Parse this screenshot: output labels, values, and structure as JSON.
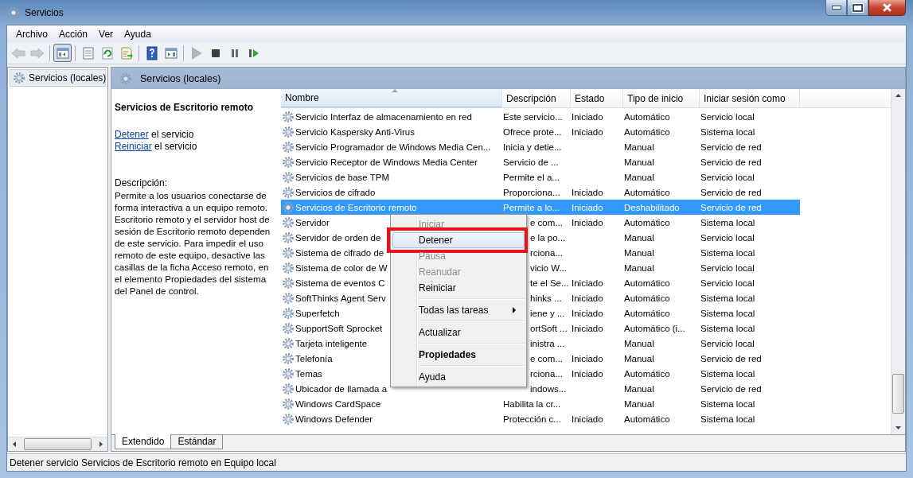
{
  "window": {
    "title": "Servicios"
  },
  "menu_bar": [
    "Archivo",
    "Acción",
    "Ver",
    "Ayuda"
  ],
  "toolbar": [
    {
      "kind": "back",
      "disabled": true
    },
    {
      "kind": "forward",
      "disabled": true
    },
    {
      "kind": "separator"
    },
    {
      "kind": "tree",
      "pressed": true
    },
    {
      "kind": "separator"
    },
    {
      "kind": "properties"
    },
    {
      "kind": "refresh"
    },
    {
      "kind": "export"
    },
    {
      "kind": "separator"
    },
    {
      "kind": "help"
    },
    {
      "kind": "panel"
    },
    {
      "kind": "separator"
    },
    {
      "kind": "play",
      "disabled": true
    },
    {
      "kind": "stop"
    },
    {
      "kind": "pause"
    },
    {
      "kind": "resume"
    }
  ],
  "tree": {
    "items": [
      {
        "label": "Servicios (locales)",
        "selected": true
      }
    ]
  },
  "pane_header": "Servicios (locales)",
  "details": {
    "title": "Servicios de Escritorio remoto",
    "actions": [
      {
        "link": "Detener",
        "text": "el servicio"
      },
      {
        "link": "Reiniciar",
        "text": "el servicio"
      }
    ],
    "description_label": "Descripción:",
    "description": "Permite a los usuarios conectarse de forma interactiva a un equipo remoto. Escritorio remoto y el servidor host de sesión de Escritorio remoto dependen de este servicio. Para impedir el uso remoto de este equipo, desactive las casillas de la ficha Acceso remoto, en el elemento Propiedades del sistema del Panel de control."
  },
  "table": {
    "columns": [
      {
        "label": "Nombre",
        "sorted": true
      },
      {
        "label": "Descripción",
        "sorted": false
      },
      {
        "label": "Estado",
        "sorted": false
      },
      {
        "label": "Tipo de inicio",
        "sorted": false
      },
      {
        "label": "Iniciar sesión como",
        "sorted": false
      }
    ],
    "rows": [
      {
        "name": "Servicio Interfaz de almacenamiento en red",
        "description": "Este servicio...",
        "status": "Iniciado",
        "startup": "Automático",
        "logon": "Servicio local",
        "selected": false
      },
      {
        "name": "Servicio Kaspersky Anti-Virus",
        "description": "Ofrece prote...",
        "status": "Iniciado",
        "startup": "Automático",
        "logon": "Sistema local",
        "selected": false
      },
      {
        "name": "Servicio Programador de Windows Media Cen...",
        "description": "Inicia y detie...",
        "startup": "Manual",
        "logon": "Servicio de red",
        "selected": false
      },
      {
        "name": "Servicio Receptor de Windows Media Center",
        "description": "Servicio de ...",
        "startup": "Manual",
        "logon": "Servicio de red",
        "selected": false
      },
      {
        "name": "Servicios de base TPM",
        "description": "Permite el a...",
        "startup": "Manual",
        "logon": "Servicio local",
        "selected": false
      },
      {
        "name": "Servicios de cifrado",
        "description": "Proporciona...",
        "status": "Iniciado",
        "startup": "Automático",
        "logon": "Servicio de red",
        "selected": false
      },
      {
        "name": "Servicios de Escritorio remoto",
        "description": "Permite a lo...",
        "status": "Iniciado",
        "startup": "Deshabilitado",
        "logon": "Servicio de red",
        "selected": true
      },
      {
        "name": "Servidor",
        "description": "e com...",
        "status": "Iniciado",
        "startup": "Automático",
        "logon": "Sistema local",
        "selected": false
      },
      {
        "name": "Servidor de orden de",
        "description": "e la po...",
        "startup": "Manual",
        "logon": "Servicio local",
        "selected": false
      },
      {
        "name": "Sistema de cifrado de",
        "description": "rciona...",
        "startup": "Manual",
        "logon": "Sistema local",
        "selected": false
      },
      {
        "name": "Sistema de color de W",
        "description": "vicio W...",
        "startup": "Manual",
        "logon": "Servicio local",
        "selected": false
      },
      {
        "name": "Sistema de eventos C",
        "description": "te el Se...",
        "status": "Iniciado",
        "startup": "Automático",
        "logon": "Servicio local",
        "selected": false
      },
      {
        "name": "SoftThinks Agent Serv",
        "description": "hinks ...",
        "status": "Iniciado",
        "startup": "Automático",
        "logon": "Sistema local",
        "selected": false
      },
      {
        "name": "Superfetch",
        "description": "iene y ...",
        "status": "Iniciado",
        "startup": "Automático",
        "logon": "Sistema local",
        "selected": false
      },
      {
        "name": "SupportSoft Sprocket",
        "description": "ortSoft ...",
        "status": "Iniciado",
        "startup": "Automático (i...",
        "logon": "Sistema local",
        "selected": false
      },
      {
        "name": "Tarjeta inteligente",
        "description": "inistra ...",
        "startup": "Manual",
        "logon": "Servicio local",
        "selected": false
      },
      {
        "name": "Telefonía",
        "description": "e com...",
        "status": "Iniciado",
        "startup": "Manual",
        "logon": "Servicio de red",
        "selected": false
      },
      {
        "name": "Temas",
        "description": "rciona...",
        "status": "Iniciado",
        "startup": "Automático",
        "logon": "Sistema local",
        "selected": false
      },
      {
        "name": "Ubicador de llamada a",
        "description": "indows...",
        "startup": "Manual",
        "logon": "Servicio de red",
        "selected": false
      },
      {
        "name": "Windows CardSpace",
        "description": "Habilita la cr...",
        "startup": "Manual",
        "logon": "Sistema local",
        "selected": false
      },
      {
        "name": "Windows Defender",
        "description": "Protección c...",
        "status": "Iniciado",
        "startup": "Automático",
        "logon": "Sistema local",
        "selected": false
      }
    ]
  },
  "context_menu": [
    {
      "kind": "item",
      "label": "Iniciar",
      "disabled": true,
      "selected": false
    },
    {
      "kind": "item",
      "label": "Detener",
      "disabled": false,
      "selected": true,
      "annotated": true
    },
    {
      "kind": "item",
      "label": "Pausa",
      "disabled": true,
      "selected": false
    },
    {
      "kind": "item",
      "label": "Reanudar",
      "disabled": true,
      "selected": false
    },
    {
      "kind": "item",
      "label": "Reiniciar",
      "disabled": false,
      "selected": false
    },
    {
      "kind": "separator"
    },
    {
      "kind": "item",
      "label": "Todas las tareas",
      "disabled": false,
      "selected": false,
      "submenu": true
    },
    {
      "kind": "separator"
    },
    {
      "kind": "item",
      "label": "Actualizar",
      "disabled": false,
      "selected": false
    },
    {
      "kind": "separator"
    },
    {
      "kind": "item",
      "label": "Propiedades",
      "disabled": false,
      "selected": false,
      "default": true
    },
    {
      "kind": "separator"
    },
    {
      "kind": "item",
      "label": "Ayuda",
      "disabled": false,
      "selected": false
    }
  ],
  "view_tabs": [
    {
      "label": "Extendido",
      "selected": true
    },
    {
      "label": "Estándar",
      "selected": false
    }
  ],
  "status_bar": "Detener servicio Servicios de Escritorio remoto en Equipo local"
}
